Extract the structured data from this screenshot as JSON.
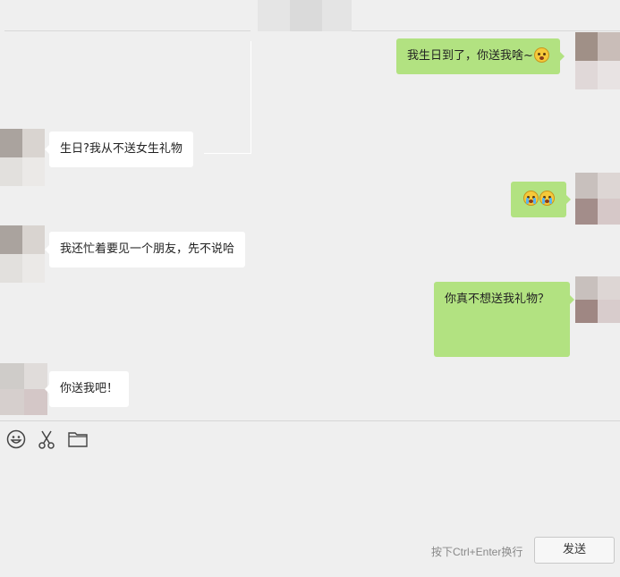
{
  "messages": [
    {
      "side": "right",
      "text": "我生日到了，你送我啥~",
      "emoji": "surprised-emoji"
    },
    {
      "side": "left",
      "text": "生日?我从不送女生礼物"
    },
    {
      "side": "right",
      "text": "",
      "emoji": "crying-emoji-pair"
    },
    {
      "side": "left",
      "text": "我还忙着要见一个朋友，先不说哈"
    },
    {
      "side": "right",
      "text": "你真不想送我礼物？"
    },
    {
      "side": "left",
      "text": "你送我吧！"
    }
  ],
  "toolbar": {
    "icons": [
      "smiley-icon",
      "scissors-icon",
      "folder-icon"
    ]
  },
  "composer": {
    "hint": "按下Ctrl+Enter换行",
    "send_label": "发送"
  },
  "colors": {
    "background": "#efefef",
    "bubble_self": "#b2e281",
    "bubble_other": "#ffffff"
  }
}
